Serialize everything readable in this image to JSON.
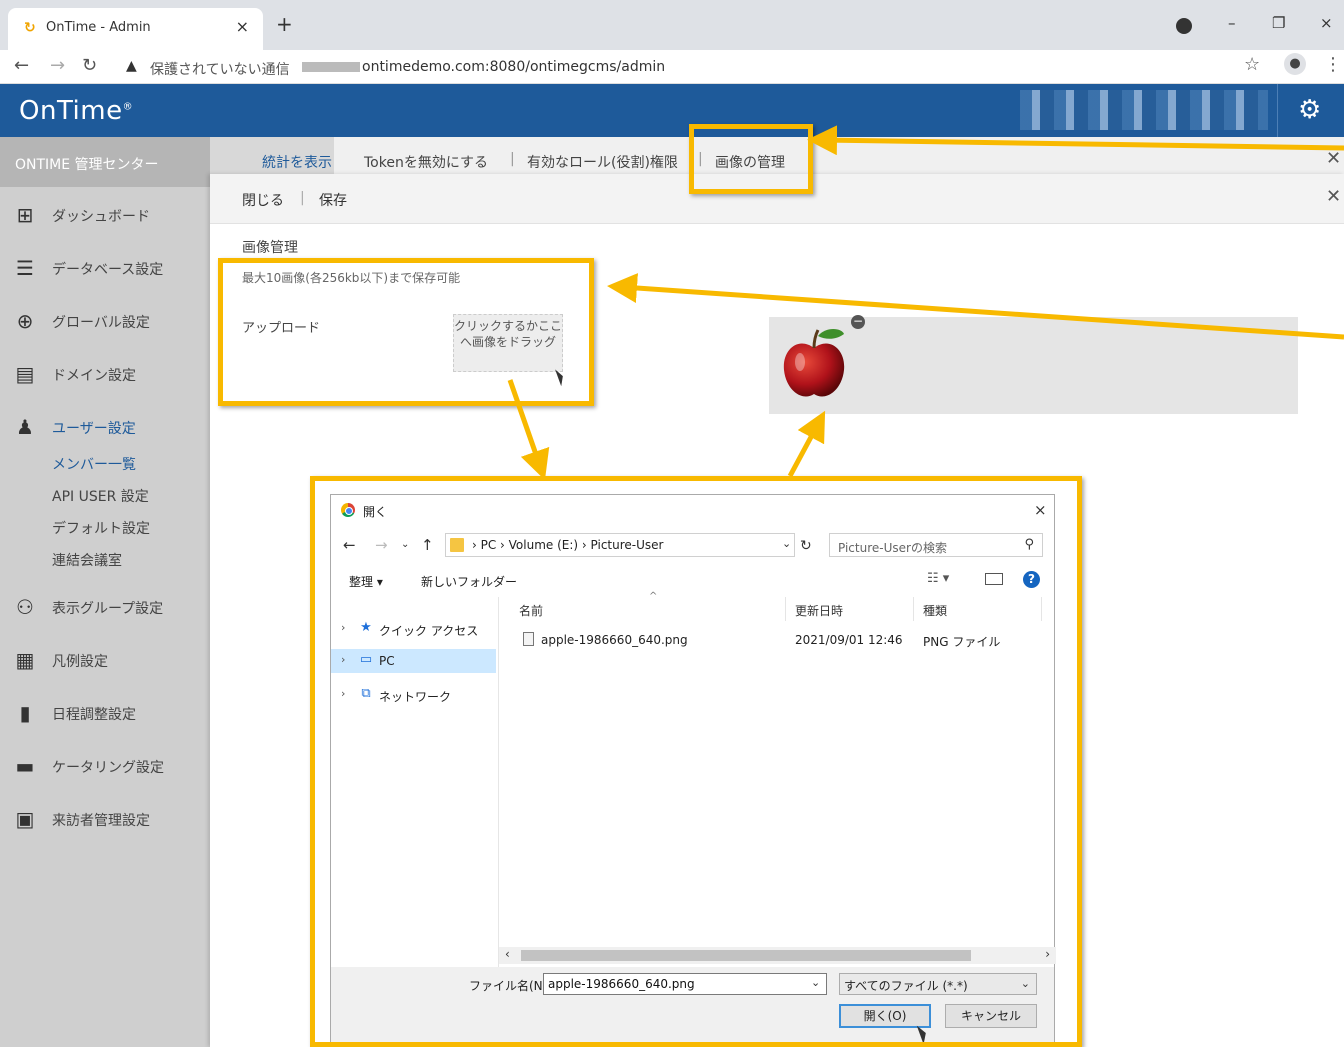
{
  "browser": {
    "tab_title": "OnTime - Admin",
    "tab_favicon": "ontime-favicon-icon",
    "new_tab": "+",
    "tab_close": "×",
    "win_minimize": "–",
    "win_restore": "❐",
    "win_close": "×",
    "security_label": "保護されていない通信",
    "url": "ontimedemo.com:8080/ontimegcms/admin"
  },
  "app": {
    "logo": "OnTime",
    "logo_mark": "®",
    "sidebar_header": "ONTIME 管理センター",
    "sidebar_items": [
      {
        "label": "ダッシュボード",
        "icon": "dashboard-icon"
      },
      {
        "label": "データベース設定",
        "icon": "database-icon"
      },
      {
        "label": "グローバル設定",
        "icon": "globe-icon"
      },
      {
        "label": "ドメイン設定",
        "icon": "server-icon"
      },
      {
        "label": "ユーザー設定",
        "icon": "user-icon"
      },
      {
        "label": "表示グループ設定",
        "icon": "group-icon"
      },
      {
        "label": "凡例設定",
        "icon": "grid-icon"
      },
      {
        "label": "日程調整設定",
        "icon": "bar-chart-icon"
      },
      {
        "label": "ケータリング設定",
        "icon": "catering-icon"
      },
      {
        "label": "来訪者管理設定",
        "icon": "visitor-icon"
      }
    ],
    "user_sub_items": [
      "メンバー一覧",
      "API USER 設定",
      "デフォルト設定",
      "連結会議室"
    ],
    "stats_tab": "統計を表示",
    "tabs": [
      "Tokenを無効にする",
      "有効なロール(役割)権限",
      "画像の管理"
    ],
    "actions": {
      "close": "閉じる",
      "separator": "|",
      "save": "保存"
    },
    "section_title": "画像管理",
    "limit_note": "最大10画像(各256kb以下)まで保存可能",
    "upload_label": "アップロード",
    "dropzone_text": "クリックするかここへ画像をドラッグ",
    "colors": {
      "brand": "#1e5a9a",
      "highlight": "#f8b900",
      "sidebar": "#cfcfcf"
    }
  },
  "dialog": {
    "title": "開く",
    "close": "×",
    "path_segments": "› PC › Volume (E:) › Picture-User",
    "search_placeholder": "Picture-Userの検索",
    "organize": "整理 ▾",
    "new_folder": "新しいフォルダー",
    "tree": [
      {
        "label": "クイック アクセス",
        "icon": "star-icon"
      },
      {
        "label": "PC",
        "icon": "computer-icon"
      },
      {
        "label": "ネットワーク",
        "icon": "network-icon"
      }
    ],
    "columns": {
      "name": "名前",
      "modified": "更新日時",
      "type": "種類"
    },
    "files": [
      {
        "name": "apple-1986660_640.png",
        "modified": "2021/09/01 12:46",
        "type": "PNG ファイル"
      }
    ],
    "filename_label": "ファイル名(N):",
    "filename_value": "apple-1986660_640.png",
    "filetype": "すべてのファイル (*.*)",
    "open_button": "開く(O)",
    "cancel_button": "キャンセル"
  }
}
